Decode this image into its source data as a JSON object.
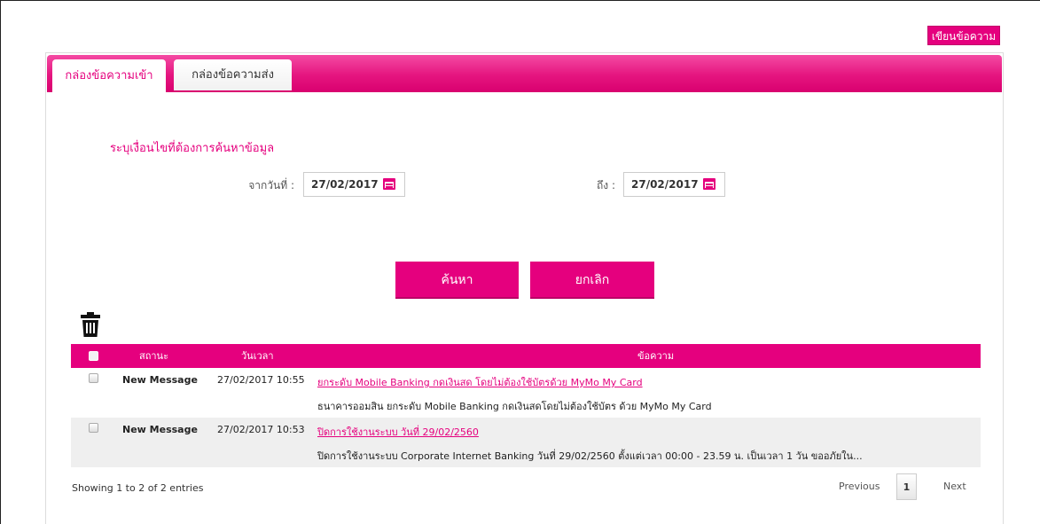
{
  "compose_label": "เขียนข้อความ",
  "tabs": [
    {
      "label": "กล่องข้อความเข้า",
      "active": true
    },
    {
      "label": "กล่องข้อความส่ง",
      "active": false
    }
  ],
  "search": {
    "title": "ระบุเงื่อนไขที่ต้องการค้นหาข้อมูล",
    "from_label": "จากวันที่ :",
    "from_value": "27/02/2017",
    "to_label": "ถึง :",
    "to_value": "27/02/2017",
    "search_button": "ค้นหา",
    "cancel_button": "ยกเลิก"
  },
  "table": {
    "headers": {
      "status": "สถานะ",
      "datetime": "วันเวลา",
      "message": "ข้อความ"
    },
    "rows": [
      {
        "status": "New Message",
        "datetime": "27/02/2017 10:55",
        "subject": "ยกระดับ Mobile Banking กดเงินสด โดยไม่ต้องใช้บัตรด้วย  MyMo My Card ",
        "body": "ธนาคารออมสิน ยกระดับ Mobile Banking กดเงินสดโดยไม่ต้องใช้บัตร ด้วย  MyMo My Card"
      },
      {
        "status": "New Message",
        "datetime": "27/02/2017 10:53",
        "subject": "ปิดการใช้งานระบบ วันที่ 29/02/2560",
        "body": "ปิดการใช้งานระบบ Corporate Internet Banking วันที่ 29/02/2560 ตั้งแต่เวลา 00:00 - 23.59 น. เป็นเวลา 1 วัน ขออภัยใน..."
      }
    ]
  },
  "footer": {
    "info": "Showing 1 to 2 of 2 entries",
    "previous": "Previous",
    "page": "1",
    "next": "Next"
  },
  "colors": {
    "accent": "#e5007e"
  },
  "icons": {
    "trash": "trash-icon",
    "calendar": "calendar-icon"
  }
}
